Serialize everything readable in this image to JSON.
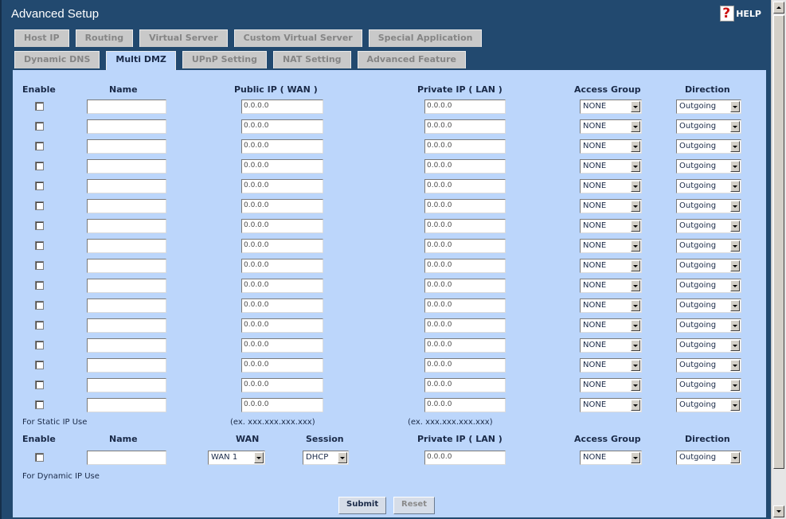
{
  "window": {
    "title": "Advanced Setup",
    "help_label": "HELP"
  },
  "tabs_row1": [
    "Host IP",
    "Routing",
    "Virtual Server",
    "Custom Virtual Server",
    "Special Application"
  ],
  "tabs_row2": [
    "Dynamic DNS",
    "Multi DMZ",
    "UPnP Setting",
    "NAT Setting",
    "Advanced Feature"
  ],
  "active_tab": "Multi DMZ",
  "static_table": {
    "headers": {
      "enable": "Enable",
      "name": "Name",
      "public_ip": "Public IP ( WAN )",
      "private_ip": "Private IP ( LAN )",
      "access_group": "Access Group",
      "direction": "Direction"
    },
    "rows": [
      {
        "enabled": false,
        "name": "",
        "public_ip": "0.0.0.0",
        "private_ip": "0.0.0.0",
        "access_group": "NONE",
        "direction": "Outgoing"
      },
      {
        "enabled": false,
        "name": "",
        "public_ip": "0.0.0.0",
        "private_ip": "0.0.0.0",
        "access_group": "NONE",
        "direction": "Outgoing"
      },
      {
        "enabled": false,
        "name": "",
        "public_ip": "0.0.0.0",
        "private_ip": "0.0.0.0",
        "access_group": "NONE",
        "direction": "Outgoing"
      },
      {
        "enabled": false,
        "name": "",
        "public_ip": "0.0.0.0",
        "private_ip": "0.0.0.0",
        "access_group": "NONE",
        "direction": "Outgoing"
      },
      {
        "enabled": false,
        "name": "",
        "public_ip": "0.0.0.0",
        "private_ip": "0.0.0.0",
        "access_group": "NONE",
        "direction": "Outgoing"
      },
      {
        "enabled": false,
        "name": "",
        "public_ip": "0.0.0.0",
        "private_ip": "0.0.0.0",
        "access_group": "NONE",
        "direction": "Outgoing"
      },
      {
        "enabled": false,
        "name": "",
        "public_ip": "0.0.0.0",
        "private_ip": "0.0.0.0",
        "access_group": "NONE",
        "direction": "Outgoing"
      },
      {
        "enabled": false,
        "name": "",
        "public_ip": "0.0.0.0",
        "private_ip": "0.0.0.0",
        "access_group": "NONE",
        "direction": "Outgoing"
      },
      {
        "enabled": false,
        "name": "",
        "public_ip": "0.0.0.0",
        "private_ip": "0.0.0.0",
        "access_group": "NONE",
        "direction": "Outgoing"
      },
      {
        "enabled": false,
        "name": "",
        "public_ip": "0.0.0.0",
        "private_ip": "0.0.0.0",
        "access_group": "NONE",
        "direction": "Outgoing"
      },
      {
        "enabled": false,
        "name": "",
        "public_ip": "0.0.0.0",
        "private_ip": "0.0.0.0",
        "access_group": "NONE",
        "direction": "Outgoing"
      },
      {
        "enabled": false,
        "name": "",
        "public_ip": "0.0.0.0",
        "private_ip": "0.0.0.0",
        "access_group": "NONE",
        "direction": "Outgoing"
      },
      {
        "enabled": false,
        "name": "",
        "public_ip": "0.0.0.0",
        "private_ip": "0.0.0.0",
        "access_group": "NONE",
        "direction": "Outgoing"
      },
      {
        "enabled": false,
        "name": "",
        "public_ip": "0.0.0.0",
        "private_ip": "0.0.0.0",
        "access_group": "NONE",
        "direction": "Outgoing"
      },
      {
        "enabled": false,
        "name": "",
        "public_ip": "0.0.0.0",
        "private_ip": "0.0.0.0",
        "access_group": "NONE",
        "direction": "Outgoing"
      },
      {
        "enabled": false,
        "name": "",
        "public_ip": "0.0.0.0",
        "private_ip": "0.0.0.0",
        "access_group": "NONE",
        "direction": "Outgoing"
      }
    ],
    "note": "For Static IP Use",
    "public_example": "(ex. xxx.xxx.xxx.xxx)",
    "private_example": "(ex. xxx.xxx.xxx.xxx)"
  },
  "dynamic_table": {
    "headers": {
      "enable": "Enable",
      "name": "Name",
      "wan": "WAN",
      "session": "Session",
      "private_ip": "Private IP ( LAN )",
      "access_group": "Access Group",
      "direction": "Direction"
    },
    "row": {
      "enabled": false,
      "name": "",
      "wan": "WAN 1",
      "session": "DHCP",
      "private_ip": "0.0.0.0",
      "access_group": "NONE",
      "direction": "Outgoing"
    },
    "note": "For Dynamic IP Use"
  },
  "buttons": {
    "submit": "Submit",
    "reset": "Reset"
  },
  "colors": {
    "frame": "#22496f",
    "panel": "#bcd6fb",
    "tab_inactive": "#c9c9c9"
  }
}
